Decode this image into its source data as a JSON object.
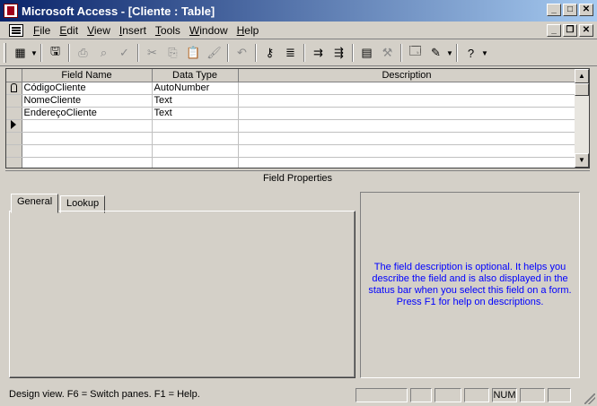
{
  "window": {
    "title": "Microsoft Access - [Cliente : Table]"
  },
  "menu": {
    "items": [
      {
        "label": "File",
        "accel": "F"
      },
      {
        "label": "Edit",
        "accel": "E"
      },
      {
        "label": "View",
        "accel": "V"
      },
      {
        "label": "Insert",
        "accel": "I"
      },
      {
        "label": "Tools",
        "accel": "T"
      },
      {
        "label": "Window",
        "accel": "W"
      },
      {
        "label": "Help",
        "accel": "H"
      }
    ]
  },
  "grid": {
    "columns": [
      "Field Name",
      "Data Type",
      "Description"
    ],
    "rows": [
      {
        "field": "CódigoCliente",
        "type": "AutoNumber",
        "description": "",
        "primary_key": true
      },
      {
        "field": "NomeCliente",
        "type": "Text",
        "description": ""
      },
      {
        "field": "EndereçoCliente",
        "type": "Text",
        "description": ""
      }
    ]
  },
  "field_properties": {
    "header": "Field Properties",
    "tabs": [
      "General",
      "Lookup"
    ],
    "active_tab": "General",
    "help_text": "The field description is optional.  It helps you describe the field and is also displayed in the status bar when you select this field on a form.  Press F1 for help on descriptions."
  },
  "status": {
    "text": "Design view.  F6 = Switch panes.  F1 = Help.",
    "num_indicator": "NUM"
  },
  "colors": {
    "titlebar_start": "#0a246a",
    "titlebar_end": "#a6caf0",
    "help_text": "#0000ff",
    "face": "#d4d0c8"
  }
}
